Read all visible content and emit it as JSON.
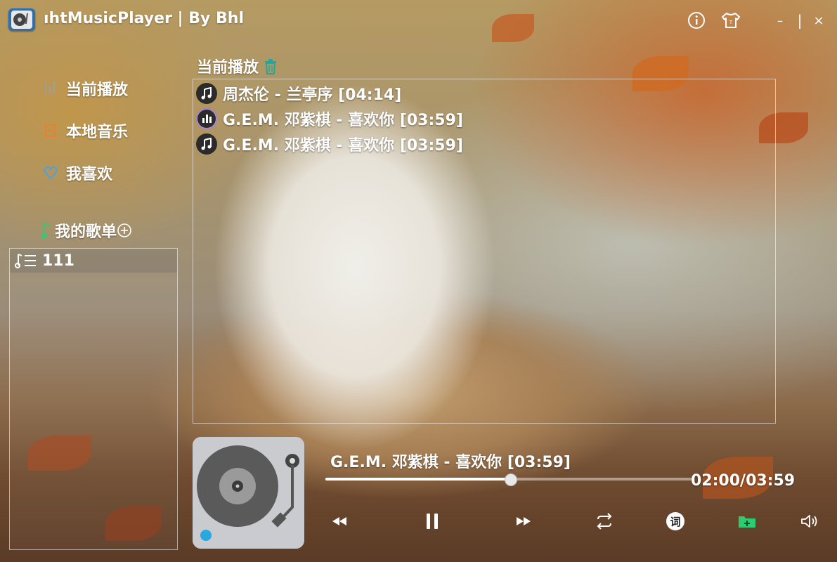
{
  "window": {
    "title": "ıhtMusicPlayer | By Bhl",
    "minimize_glyph": "–",
    "maximize_glyph": "|",
    "close_glyph": "×"
  },
  "sidebar": {
    "items": [
      {
        "label": "当前播放",
        "icon": "bars-icon",
        "color": "#9e9e9e"
      },
      {
        "label": "本地音乐",
        "icon": "local-music-icon",
        "color": "#e8802e"
      },
      {
        "label": "我喜欢",
        "icon": "heart-icon",
        "color": "#4aa3df"
      }
    ],
    "playlists_header": "我的歌单",
    "playlists_icon_color": "#2ecc71",
    "playlists": [
      {
        "name": "111"
      }
    ]
  },
  "now_playing": {
    "header": "当前播放",
    "clear_icon_color": "#26a69a",
    "queue": [
      {
        "text": "周杰伦 - 兰亭序 [04:14]",
        "icon": "music-note-icon",
        "playing": false
      },
      {
        "text": "G.E.M. 邓紫棋 - 喜欢你 [03:59]",
        "icon": "equalizer-icon",
        "playing": true
      },
      {
        "text": "G.E.M. 邓紫棋 - 喜欢你 [03:59]",
        "icon": "music-note-icon",
        "playing": false
      }
    ]
  },
  "player": {
    "song": "G.E.M. 邓紫棋 - 喜欢你 [03:59]",
    "time": "02:00/03:59",
    "progress": 0.503,
    "lyrics_label": "词"
  },
  "colors": {
    "accent_blue": "#29a8e0",
    "folder_green": "#2ecc71"
  }
}
